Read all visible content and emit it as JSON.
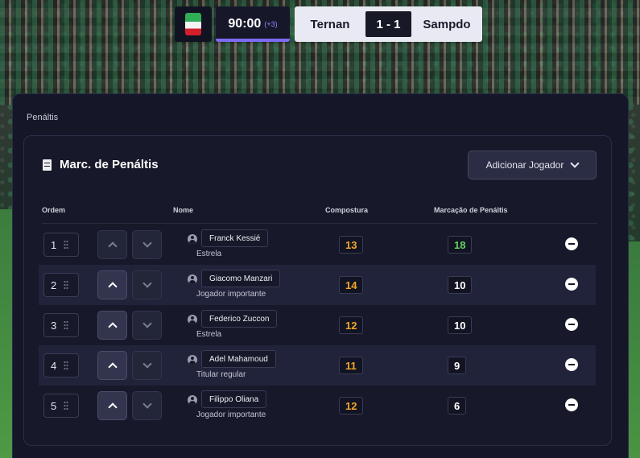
{
  "scoreboard": {
    "clock": "90:00",
    "added_time": "(+3)",
    "home_team": "Ternan",
    "score": "1 - 1",
    "away_team": "Sampdo"
  },
  "panel": {
    "title": "Penáltis"
  },
  "card": {
    "title": "Marc. de Penáltis",
    "add_button_label": "Adicionar Jogador"
  },
  "table": {
    "headers": {
      "order": "Ordem",
      "name": "Nome",
      "composure": "Compostura",
      "penalties": "Marcação de Penáltis"
    },
    "rows": [
      {
        "order": "1",
        "name": "Franck Kessié",
        "status": "Estrela",
        "composure": "13",
        "penalties": "18"
      },
      {
        "order": "2",
        "name": "Giacomo Manzari",
        "status": "Jogador importante",
        "composure": "14",
        "penalties": "10"
      },
      {
        "order": "3",
        "name": "Federico Zuccon",
        "status": "Estrela",
        "composure": "12",
        "penalties": "10"
      },
      {
        "order": "4",
        "name": "Adel Mahamoud",
        "status": "Titular regular",
        "composure": "11",
        "penalties": "9"
      },
      {
        "order": "5",
        "name": "Filippo Oliana",
        "status": "Jogador importante",
        "composure": "12",
        "penalties": "6"
      }
    ]
  },
  "colors": {
    "composure": "#f0a72b",
    "penalty_high": "#63d45b",
    "accent": "#7c6cf2"
  }
}
